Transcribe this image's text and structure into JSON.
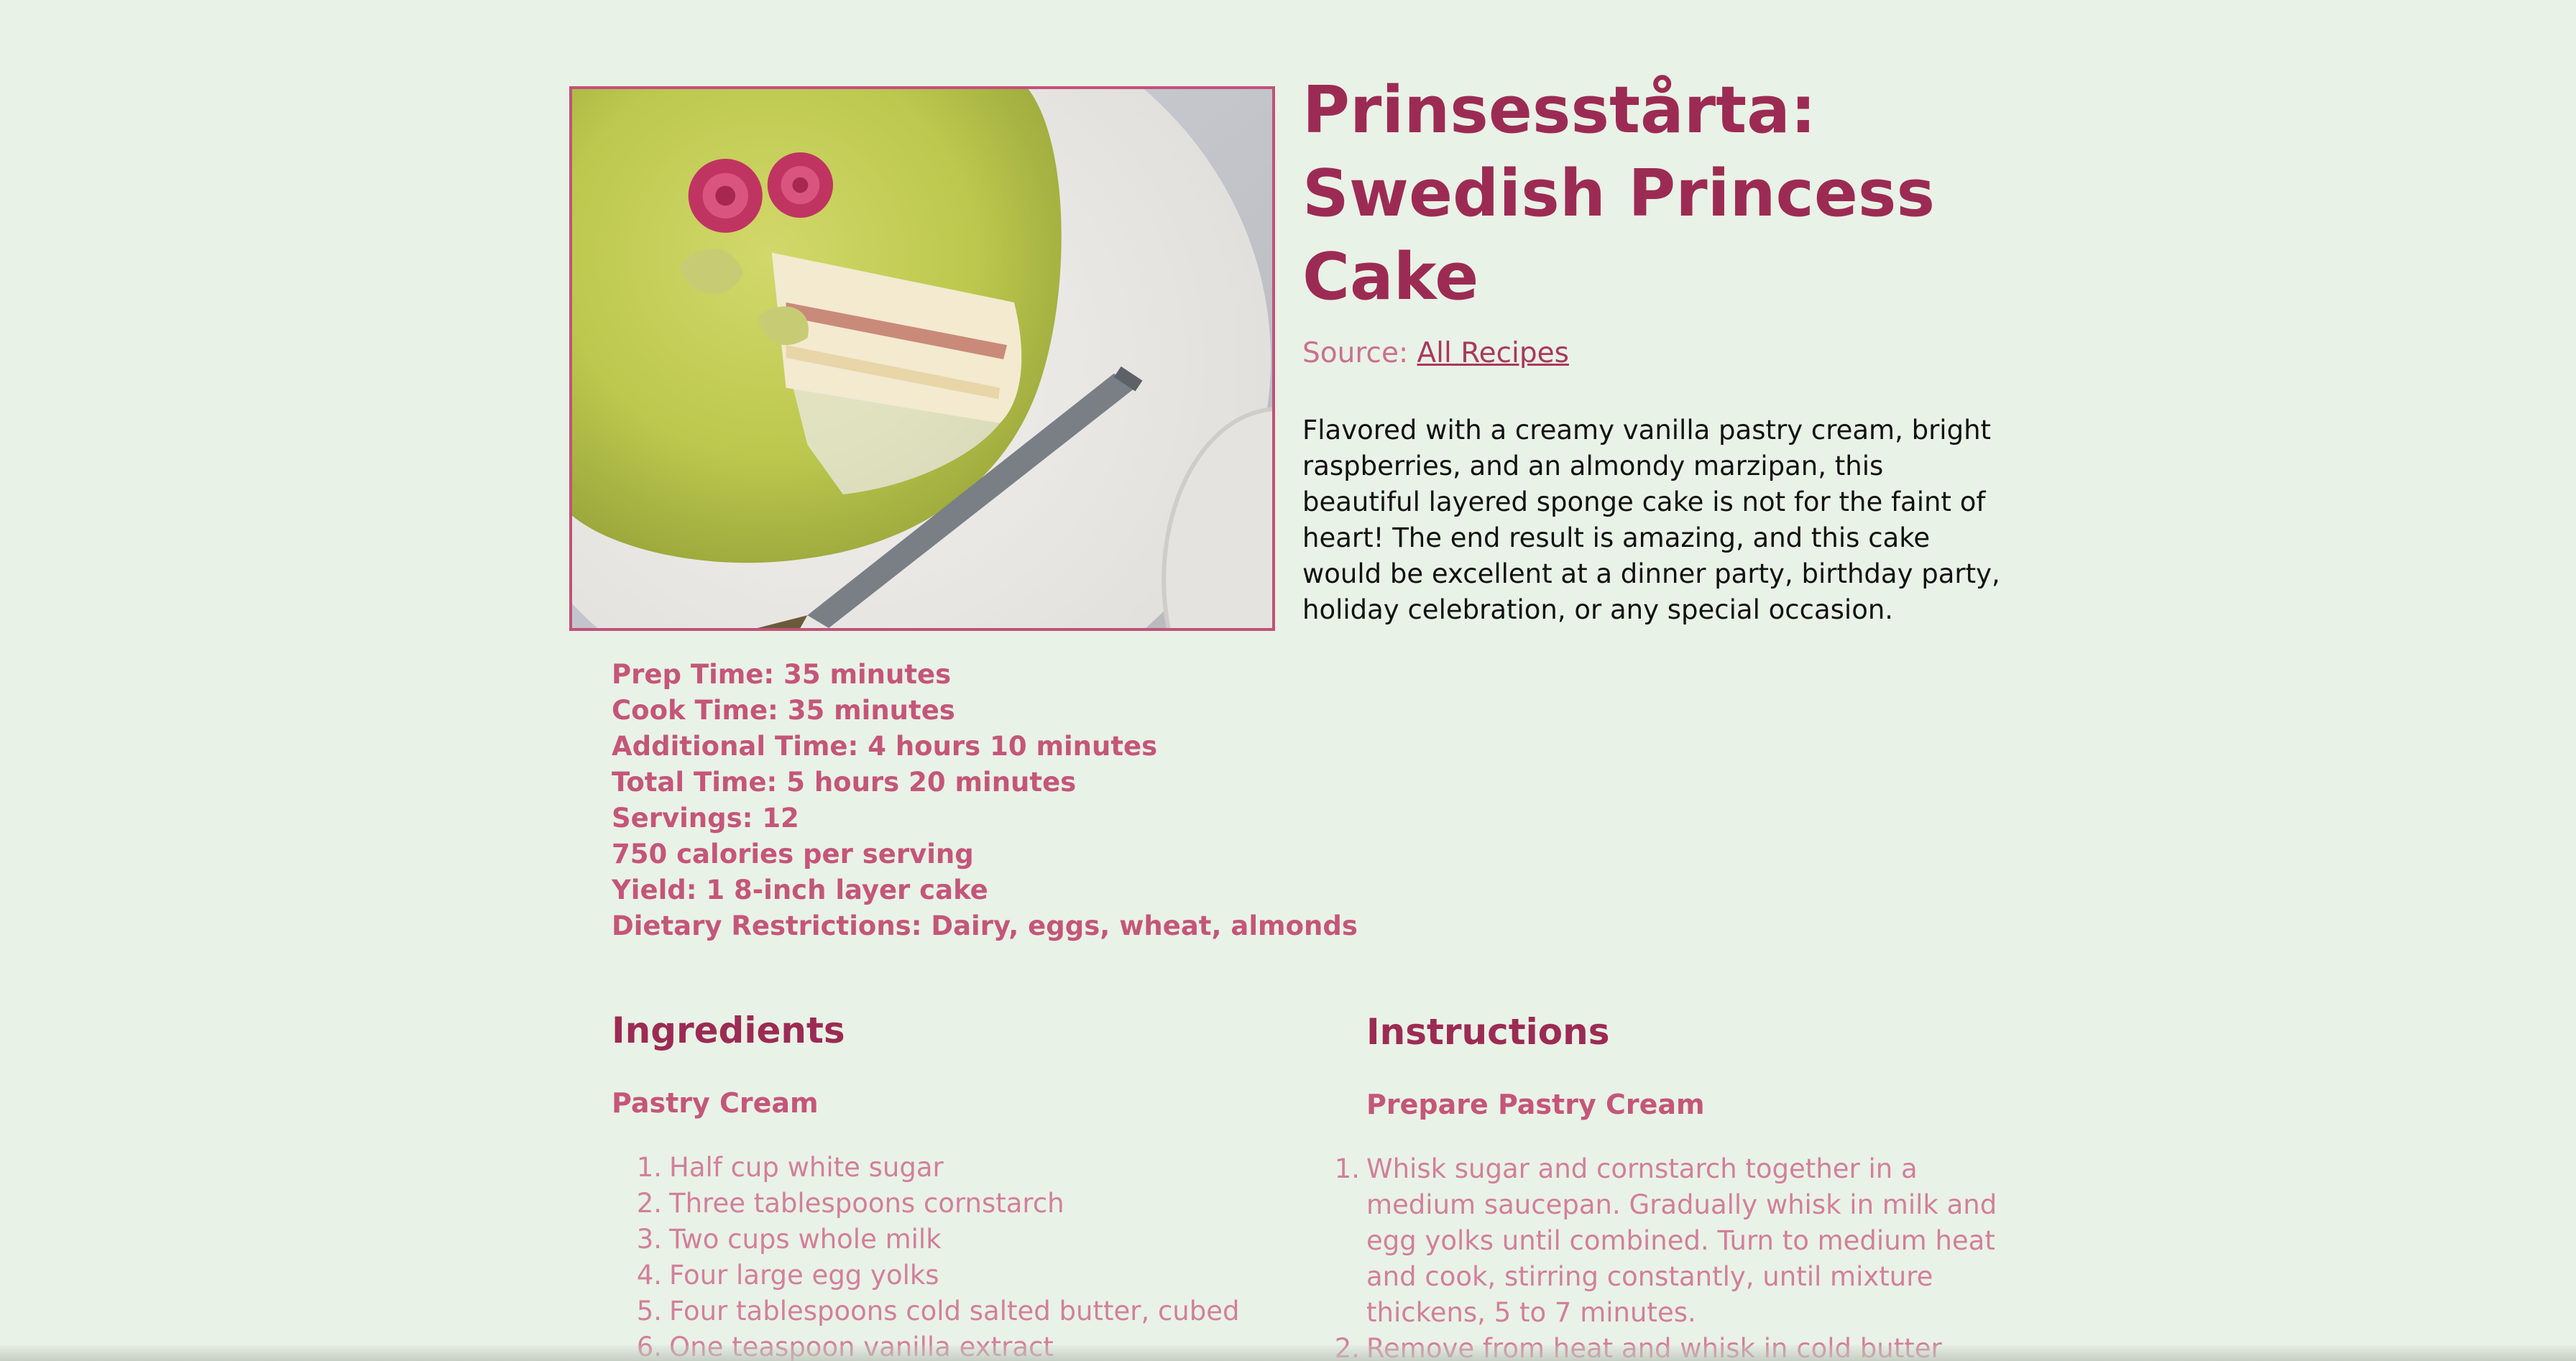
{
  "recipe": {
    "title": "Prinsesstårta: Swedish Princess Cake",
    "source_label": "Source:",
    "source_link": "All Recipes",
    "description": "Flavored with a creamy vanilla pastry cream, bright raspberries, and an almondy marzipan, this beautiful layered sponge cake is not for the faint of heart! The end result is amazing, and this cake would be excellent at a dinner party, birthday party, holiday celebration, or any special occasion.",
    "image_subject": "princess-cake-photo"
  },
  "meta": [
    "Prep Time: 35 minutes",
    "Cook Time: 35 minutes",
    "Additional Time: 4 hours 10 minutes",
    "Total Time: 5 hours 20 minutes",
    "Servings: 12",
    "750 calories per serving",
    "Yield: 1 8-inch layer cake",
    "Dietary Restrictions: Dairy, eggs, wheat, almonds"
  ],
  "ingredients": {
    "heading": "Ingredients",
    "section_title": "Pastry Cream",
    "items": [
      {
        "num": "1.",
        "text": "Half cup white sugar"
      },
      {
        "num": "2.",
        "text": "Three tablespoons cornstarch"
      },
      {
        "num": "3.",
        "text": "Two cups whole milk"
      },
      {
        "num": "4.",
        "text": "Four large egg yolks"
      },
      {
        "num": "5.",
        "text": "Four tablespoons cold salted butter, cubed"
      },
      {
        "num": "6.",
        "text": "One teaspoon vanilla extract"
      }
    ]
  },
  "instructions": {
    "heading": "Instructions",
    "section_title": "Prepare Pastry Cream",
    "steps": [
      {
        "num": "1.",
        "text": "Whisk sugar and cornstarch together in a medium saucepan. Gradually whisk in milk and egg yolks until combined. Turn to medium heat and cook, stirring constantly, until mixture thickens, 5 to 7 minutes."
      },
      {
        "num": "2.",
        "text": "Remove from heat and whisk in cold butter"
      }
    ]
  },
  "colors": {
    "background": "#e9f2e6",
    "title": "#9c2b54",
    "accent": "#c4567a",
    "list_text": "#d27f9c"
  }
}
